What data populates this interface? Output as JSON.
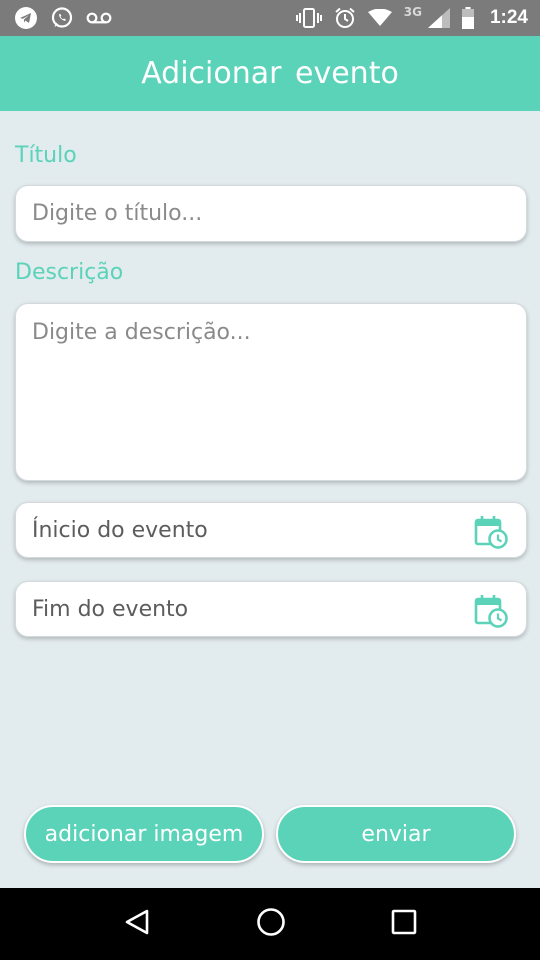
{
  "status_bar": {
    "time": "1:24",
    "network": "3G",
    "icons": [
      "telegram-icon",
      "whatsapp-icon",
      "voicemail-icon",
      "vibrate-icon",
      "alarm-icon",
      "wifi-icon",
      "signal-icon",
      "battery-icon"
    ]
  },
  "header": {
    "title": "Adicionar  evento"
  },
  "form": {
    "title_label": "Título",
    "title_placeholder": "Digite o título...",
    "description_label": "Descrição",
    "description_placeholder": "Digite a descrição...",
    "start_text": "Ínicio do evento",
    "end_text": "Fim do evento"
  },
  "buttons": {
    "add_image": "adicionar imagem",
    "send": "enviar"
  },
  "colors": {
    "accent": "#5bd3b9",
    "background": "#e2ebee",
    "status_bar": "#7b7b7b"
  }
}
